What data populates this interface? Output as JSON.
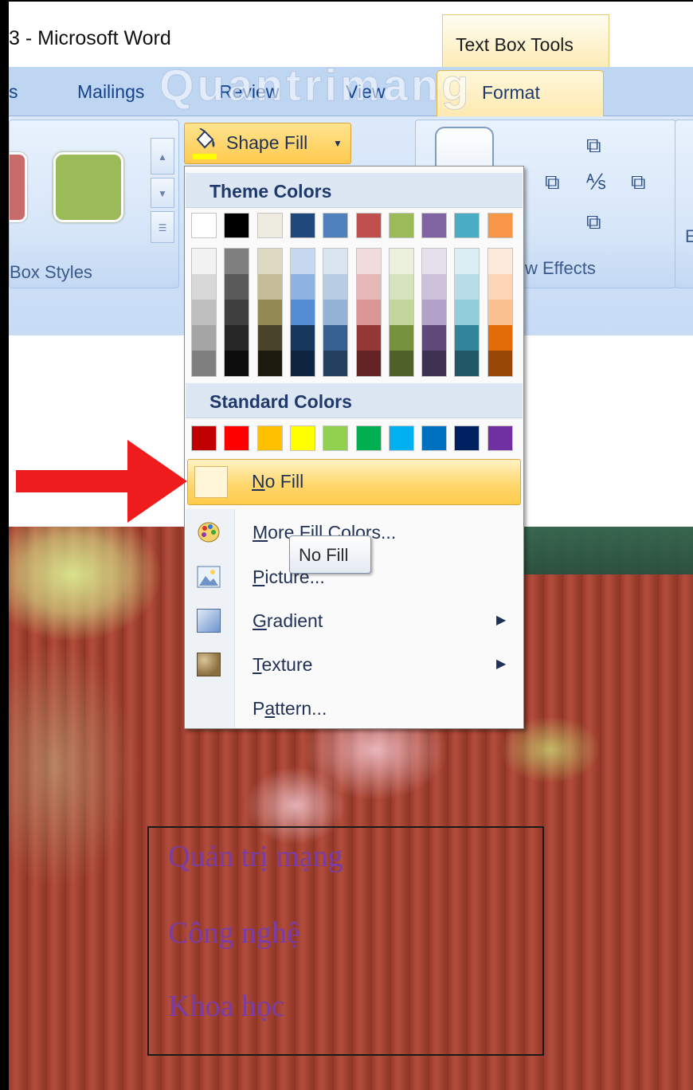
{
  "window": {
    "title": "3 - Microsoft Word",
    "context_tab_header": "Text Box Tools"
  },
  "tabs": [
    {
      "label": "s"
    },
    {
      "label": "Mailings"
    },
    {
      "label": "Review"
    },
    {
      "label": "View"
    },
    {
      "label": "Format",
      "active": true
    }
  ],
  "ribbon": {
    "text_box_styles_label": "Box Styles",
    "shape_fill_label": "Shape Fill",
    "shadow_effects_label": "w Effects",
    "cut_off_label": "E"
  },
  "dropdown": {
    "theme_colors_header": "Theme Colors",
    "theme_colors": [
      "#ffffff",
      "#000000",
      "#eeece1",
      "#1f497d",
      "#4f81bd",
      "#c0504d",
      "#9bbb59",
      "#8064a2",
      "#4bacc6",
      "#f79646"
    ],
    "theme_shades": [
      [
        "#f2f2f2",
        "#d8d8d8",
        "#bfbfbf",
        "#a5a5a5",
        "#7f7f7f"
      ],
      [
        "#7f7f7f",
        "#595959",
        "#3f3f3f",
        "#262626",
        "#0c0c0c"
      ],
      [
        "#ddd9c3",
        "#c4bd97",
        "#938953",
        "#494429",
        "#1d1b10"
      ],
      [
        "#c6d9f0",
        "#8db3e2",
        "#548dd4",
        "#17365d",
        "#0f243e"
      ],
      [
        "#dbe5f1",
        "#b8cce4",
        "#95b3d7",
        "#366092",
        "#244061"
      ],
      [
        "#f2dcdb",
        "#e5b9b7",
        "#d99694",
        "#953734",
        "#632423"
      ],
      [
        "#ebf1dd",
        "#d7e3bc",
        "#c3d69b",
        "#76923c",
        "#4f6128"
      ],
      [
        "#e5e0ec",
        "#ccc1d9",
        "#b2a2c7",
        "#5f497a",
        "#3f3151"
      ],
      [
        "#dbeef3",
        "#b7dde8",
        "#92cddc",
        "#31859b",
        "#205867"
      ],
      [
        "#fdeada",
        "#fbd5b5",
        "#fac08f",
        "#e36c09",
        "#974806"
      ]
    ],
    "standard_colors_header": "Standard Colors",
    "standard_colors": [
      "#c00000",
      "#ff0000",
      "#ffc000",
      "#ffff00",
      "#92d050",
      "#00b050",
      "#00b0f0",
      "#0070c0",
      "#002060",
      "#7030a0"
    ],
    "no_fill": {
      "mnemonic": "N",
      "rest": "o Fill"
    },
    "more_fill_colors": {
      "pre": "",
      "mnemonic": "M",
      "rest": "ore Fill Colors..."
    },
    "picture": {
      "pre": "",
      "mnemonic": "P",
      "rest": "icture..."
    },
    "gradient": {
      "pre": "",
      "mnemonic": "G",
      "rest": "radient"
    },
    "texture": {
      "pre": "",
      "mnemonic": "T",
      "rest": "exture"
    },
    "pattern": {
      "pre": "P",
      "mnemonic": "a",
      "rest": "ttern..."
    }
  },
  "tooltip": "No Fill",
  "watermark": "Quantrimang",
  "textbox_lines": [
    "Quản trị mạng",
    "Công nghệ",
    "Khoa học"
  ],
  "colors": {
    "arrow": "#ee1c1c",
    "textbox_text": "#7a3ca6"
  }
}
